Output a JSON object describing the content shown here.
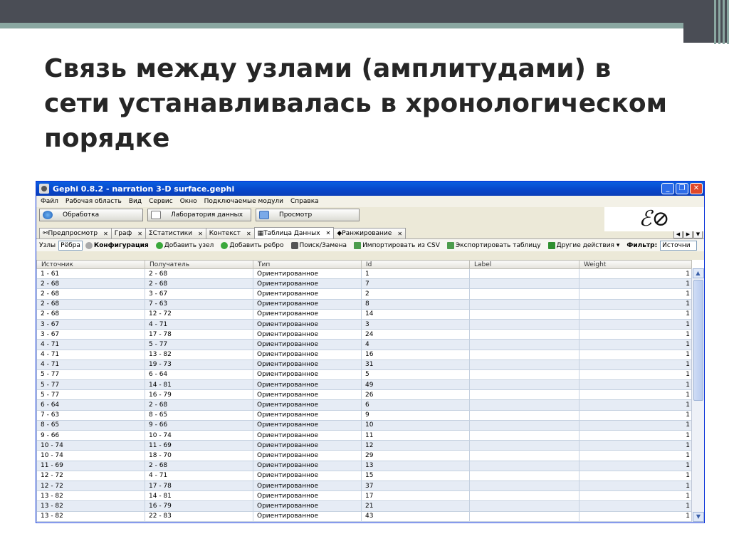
{
  "slide": {
    "title_lines": [
      "Связь между узлами (амплитудами) в",
      "сети устанавливалась в хронологическом",
      "порядке"
    ],
    "colors": {
      "dark_bar": "#4a4d55",
      "accent_stripe": "#8aa7a1"
    }
  },
  "window": {
    "title": "Gephi 0.8.2 - narration 3-D surface.gephi",
    "menu": [
      "Файл",
      "Рабочая область",
      "Вид",
      "Сервис",
      "Окно",
      "Подключаемые модули",
      "Справка"
    ],
    "perspectives": [
      "Обработка",
      "Лаборатория данных",
      "Просмотр"
    ],
    "tabs": [
      "Предпросмотр",
      "Граф",
      "Статистики",
      "Контекст",
      "Таблица Данных",
      "Ранжирование"
    ],
    "active_tab": "Таблица Данных",
    "toolbar": {
      "nodes_label": "Узлы",
      "edges_value": "Рёбра",
      "config_label": "Конфигурация",
      "add_node": "Добавить узел",
      "add_edge": "Добавить ребро",
      "search_replace": "Поиск/Замена",
      "import_csv": "Импортировать из CSV",
      "export_table": "Экспортировать таблицу",
      "other_actions": "Другие действия",
      "filter_label": "Фильтр:",
      "filter_value": "Источни"
    },
    "table": {
      "headers": [
        "Источник",
        "Получатель",
        "Тип",
        "Id",
        "Label",
        "Weight"
      ],
      "rows": [
        [
          "1 - 61",
          "2 - 68",
          "Ориентированное",
          "1",
          "",
          "1"
        ],
        [
          "2 - 68",
          "2 - 68",
          "Ориентированное",
          "7",
          "",
          "1"
        ],
        [
          "2 - 68",
          "3 - 67",
          "Ориентированное",
          "2",
          "",
          "1"
        ],
        [
          "2 - 68",
          "7 - 63",
          "Ориентированное",
          "8",
          "",
          "1"
        ],
        [
          "2 - 68",
          "12 - 72",
          "Ориентированное",
          "14",
          "",
          "1"
        ],
        [
          "3 - 67",
          "4 - 71",
          "Ориентированное",
          "3",
          "",
          "1"
        ],
        [
          "3 - 67",
          "17 - 78",
          "Ориентированное",
          "24",
          "",
          "1"
        ],
        [
          "4 - 71",
          "5 - 77",
          "Ориентированное",
          "4",
          "",
          "1"
        ],
        [
          "4 - 71",
          "13 - 82",
          "Ориентированное",
          "16",
          "",
          "1"
        ],
        [
          "4 - 71",
          "19 - 73",
          "Ориентированное",
          "31",
          "",
          "1"
        ],
        [
          "5 - 77",
          "6 - 64",
          "Ориентированное",
          "5",
          "",
          "1"
        ],
        [
          "5 - 77",
          "14 - 81",
          "Ориентированное",
          "49",
          "",
          "1"
        ],
        [
          "5 - 77",
          "16 - 79",
          "Ориентированное",
          "26",
          "",
          "1"
        ],
        [
          "6 - 64",
          "2 - 68",
          "Ориентированное",
          "6",
          "",
          "1"
        ],
        [
          "7 - 63",
          "8 - 65",
          "Ориентированное",
          "9",
          "",
          "1"
        ],
        [
          "8 - 65",
          "9 - 66",
          "Ориентированное",
          "10",
          "",
          "1"
        ],
        [
          "9 - 66",
          "10 - 74",
          "Ориентированное",
          "11",
          "",
          "1"
        ],
        [
          "10 - 74",
          "11 - 69",
          "Ориентированное",
          "12",
          "",
          "1"
        ],
        [
          "10 - 74",
          "18 - 70",
          "Ориентированное",
          "29",
          "",
          "1"
        ],
        [
          "11 - 69",
          "2 - 68",
          "Ориентированное",
          "13",
          "",
          "1"
        ],
        [
          "12 - 72",
          "4 - 71",
          "Ориентированное",
          "15",
          "",
          "1"
        ],
        [
          "12 - 72",
          "17 - 78",
          "Ориентированное",
          "37",
          "",
          "1"
        ],
        [
          "13 - 82",
          "14 - 81",
          "Ориентированное",
          "17",
          "",
          "1"
        ],
        [
          "13 - 82",
          "16 - 79",
          "Ориентированное",
          "21",
          "",
          "1"
        ],
        [
          "13 - 82",
          "22 - 83",
          "Ориентированное",
          "43",
          "",
          "1"
        ]
      ]
    }
  }
}
